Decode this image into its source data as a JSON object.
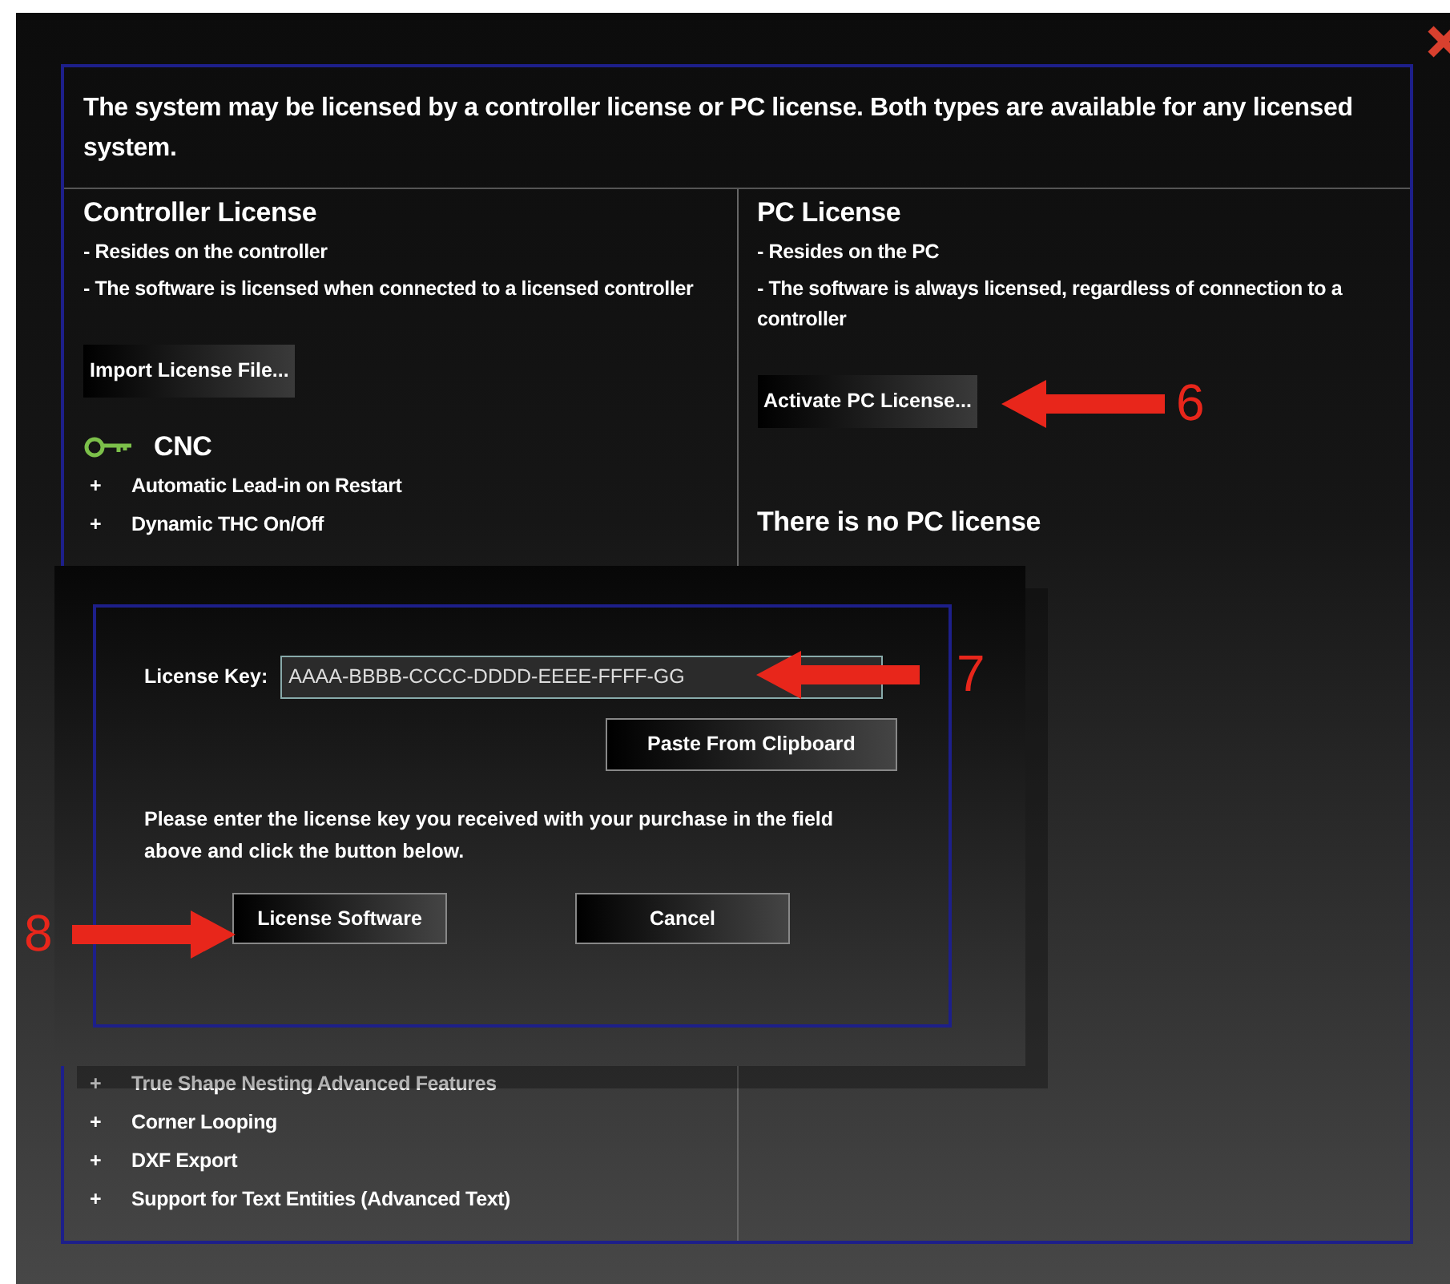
{
  "intro": "The system may be licensed by a controller license or PC license.  Both types are available for any licensed system.",
  "controller": {
    "title": "Controller License",
    "notes": [
      "- Resides on the controller",
      "- The software is licensed when connected to a licensed controller"
    ],
    "button": "Import License File...",
    "product": "CNC",
    "features_top": [
      {
        "bullet": "+",
        "label": "Automatic Lead-in on Restart"
      },
      {
        "bullet": "+",
        "label": "Dynamic THC On/Off"
      }
    ],
    "features_bottom": [
      {
        "bullet": "+",
        "label": "True Shape Nesting Advanced Features"
      },
      {
        "bullet": "+",
        "label": "Corner Looping"
      },
      {
        "bullet": "+",
        "label": "DXF Export"
      },
      {
        "bullet": "+",
        "label": "Support for Text Entities (Advanced Text)"
      }
    ]
  },
  "pc": {
    "title": "PC License",
    "notes": [
      "- Resides on the PC",
      "- The software is always licensed, regardless of connection to a controller"
    ],
    "button": "Activate PC License...",
    "status": "There is no PC license"
  },
  "dialog": {
    "key_label": "License Key:",
    "key_value": "AAAA-BBBB-CCCC-DDDD-EEEE-FFFF-GG",
    "paste_button": "Paste From Clipboard",
    "instructions": "Please enter the license key you received with your purchase in the field above and click the button below.",
    "ok_button": "License Software",
    "cancel_button": "Cancel"
  },
  "annotations": [
    {
      "number": "6",
      "kind": "leftarrow"
    },
    {
      "number": "7",
      "kind": "leftarrow"
    },
    {
      "number": "8",
      "kind": "rightarrow"
    }
  ]
}
